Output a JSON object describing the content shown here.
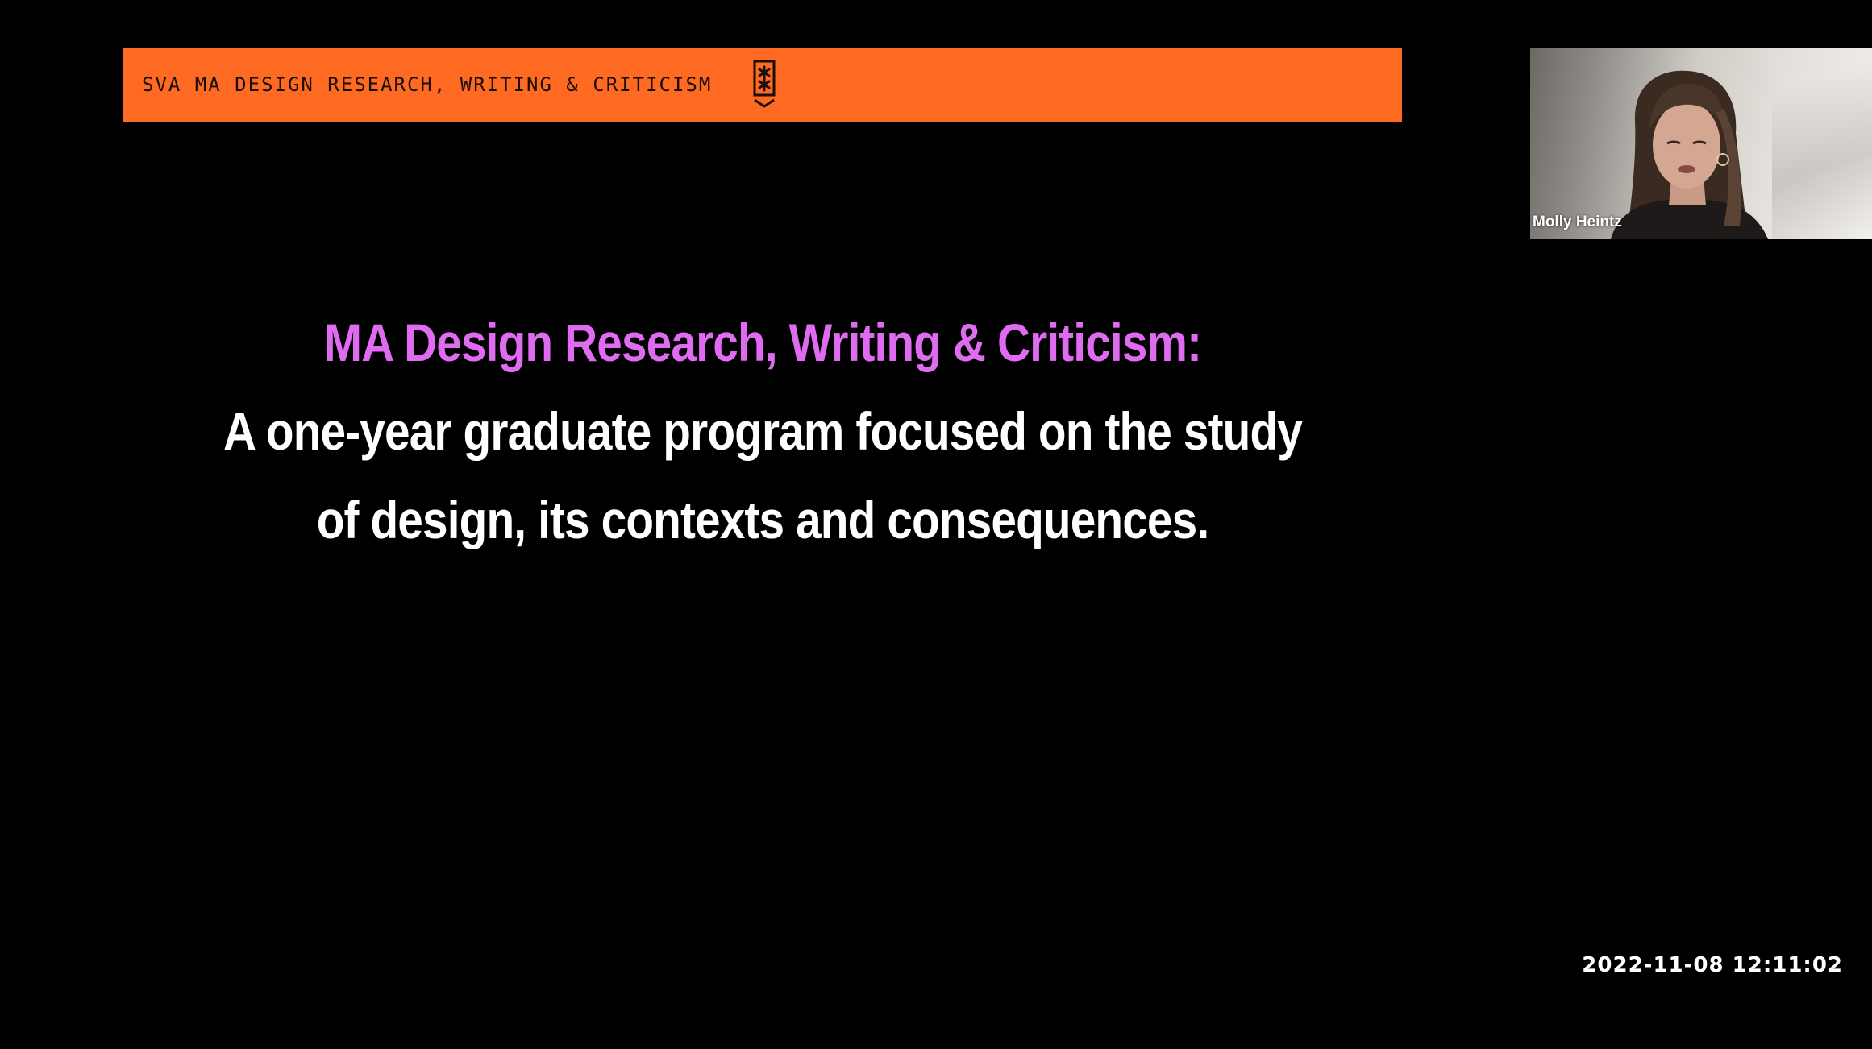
{
  "slide": {
    "banner_text": "SVA MA DESIGN RESEARCH, WRITING & CRITICISM",
    "banner_color": "#ff6a22",
    "logo_icon": "sva-logo-icon",
    "heading": "MA Design Research, Writing & Criticism:",
    "heading_color": "#df6cf0",
    "subtext_lines": [
      "A one-year graduate program focused on the study",
      "of design, its contexts and consequences."
    ]
  },
  "participant": {
    "name": "Molly Heintz"
  },
  "timestamp": "2022-11-08  12:11:02"
}
